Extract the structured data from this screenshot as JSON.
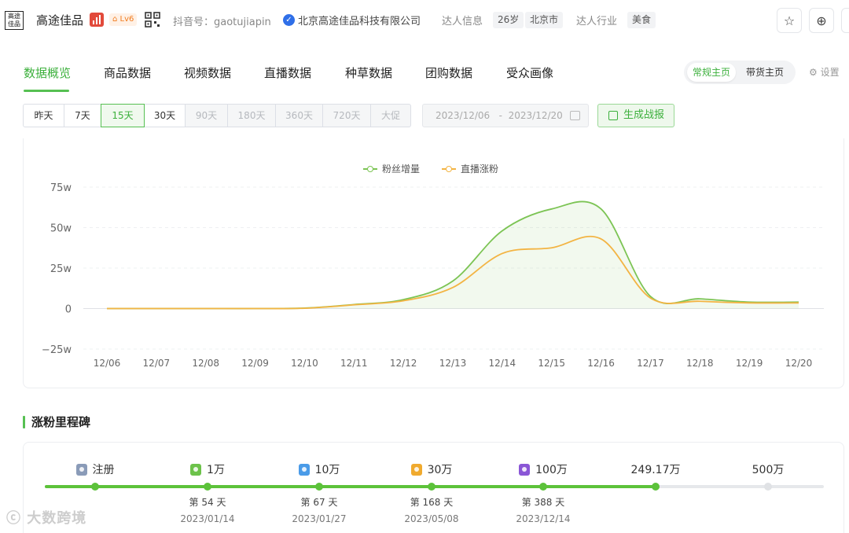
{
  "header": {
    "logo_text": "高途佳品",
    "name": "高途佳品",
    "level": "Lv6",
    "douyin_label": "抖音号：gaotujiapin",
    "company": "北京高途佳品科技有限公司",
    "info_label": "达人信息",
    "age": "26岁",
    "city": "北京市",
    "industry_label": "达人行业",
    "industry": "美食",
    "icons": [
      "star-icon",
      "plus-circle-icon"
    ]
  },
  "tabs": [
    {
      "label": "数据概览",
      "active": true
    },
    {
      "label": "商品数据"
    },
    {
      "label": "视频数据"
    },
    {
      "label": "直播数据"
    },
    {
      "label": "种草数据"
    },
    {
      "label": "团购数据"
    },
    {
      "label": "受众画像"
    }
  ],
  "home_switch": {
    "regular": "常规主页",
    "sales": "带货主页",
    "active": "常规主页"
  },
  "settings_label": "设置",
  "ranges": [
    {
      "label": "昨天",
      "state": "normal"
    },
    {
      "label": "7天",
      "state": "normal"
    },
    {
      "label": "15天",
      "state": "active"
    },
    {
      "label": "30天",
      "state": "normal"
    },
    {
      "label": "90天",
      "state": "disabled"
    },
    {
      "label": "180天",
      "state": "disabled"
    },
    {
      "label": "360天",
      "state": "disabled"
    },
    {
      "label": "720天",
      "state": "disabled"
    },
    {
      "label": "大促",
      "state": "disabled"
    }
  ],
  "date_range": {
    "start": "2023/12/06",
    "separator": "-",
    "end": "2023/12/20"
  },
  "report_button": "生成战报",
  "colors": {
    "accent": "#56c052",
    "series_fans": "#7cc454",
    "series_live": "#f3b443"
  },
  "chart_data": {
    "type": "line",
    "x": [
      "12/06",
      "12/07",
      "12/08",
      "12/09",
      "12/10",
      "12/11",
      "12/12",
      "12/13",
      "12/14",
      "12/15",
      "12/16",
      "12/17",
      "12/18",
      "12/19",
      "12/20"
    ],
    "y_ticks": [
      "75w",
      "50w",
      "25w",
      "0",
      "−25w"
    ],
    "ylim": [
      -25,
      75
    ],
    "y_unit": "w",
    "grid": true,
    "legend_position": "top-center",
    "series": [
      {
        "name": "粉丝增量",
        "color": "#7cc454",
        "area": true,
        "values": [
          0,
          0,
          0,
          0,
          0.3,
          2.5,
          5.5,
          17,
          48,
          61.5,
          61.5,
          7.5,
          6,
          4,
          4
        ]
      },
      {
        "name": "直播涨粉",
        "color": "#f3b443",
        "area": false,
        "values": [
          0,
          0,
          0,
          0,
          0.2,
          2.3,
          4.8,
          13,
          34,
          37.5,
          43,
          6.5,
          4.5,
          3.5,
          3.5
        ]
      }
    ]
  },
  "milestones": {
    "title": "涨粉里程碑",
    "items": [
      {
        "label": "注册",
        "badge": "#8a9bb8",
        "day": "",
        "date": "",
        "reached": true
      },
      {
        "label": "1万",
        "badge": "#6cc24a",
        "day": "第 54 天",
        "date": "2023/01/14",
        "reached": true
      },
      {
        "label": "10万",
        "badge": "#4a9be8",
        "day": "第 67 天",
        "date": "2023/01/27",
        "reached": true
      },
      {
        "label": "30万",
        "badge": "#f0aa2e",
        "day": "第 168 天",
        "date": "2023/05/08",
        "reached": true
      },
      {
        "label": "100万",
        "badge": "#8a56d6",
        "day": "第 388 天",
        "date": "2023/12/14",
        "reached": true
      },
      {
        "label": "249.17万",
        "badge": "",
        "day": "",
        "date": "",
        "reached": true
      },
      {
        "label": "500万",
        "badge": "",
        "day": "",
        "date": "",
        "reached": false
      }
    ]
  },
  "watermark": "大数跨境"
}
